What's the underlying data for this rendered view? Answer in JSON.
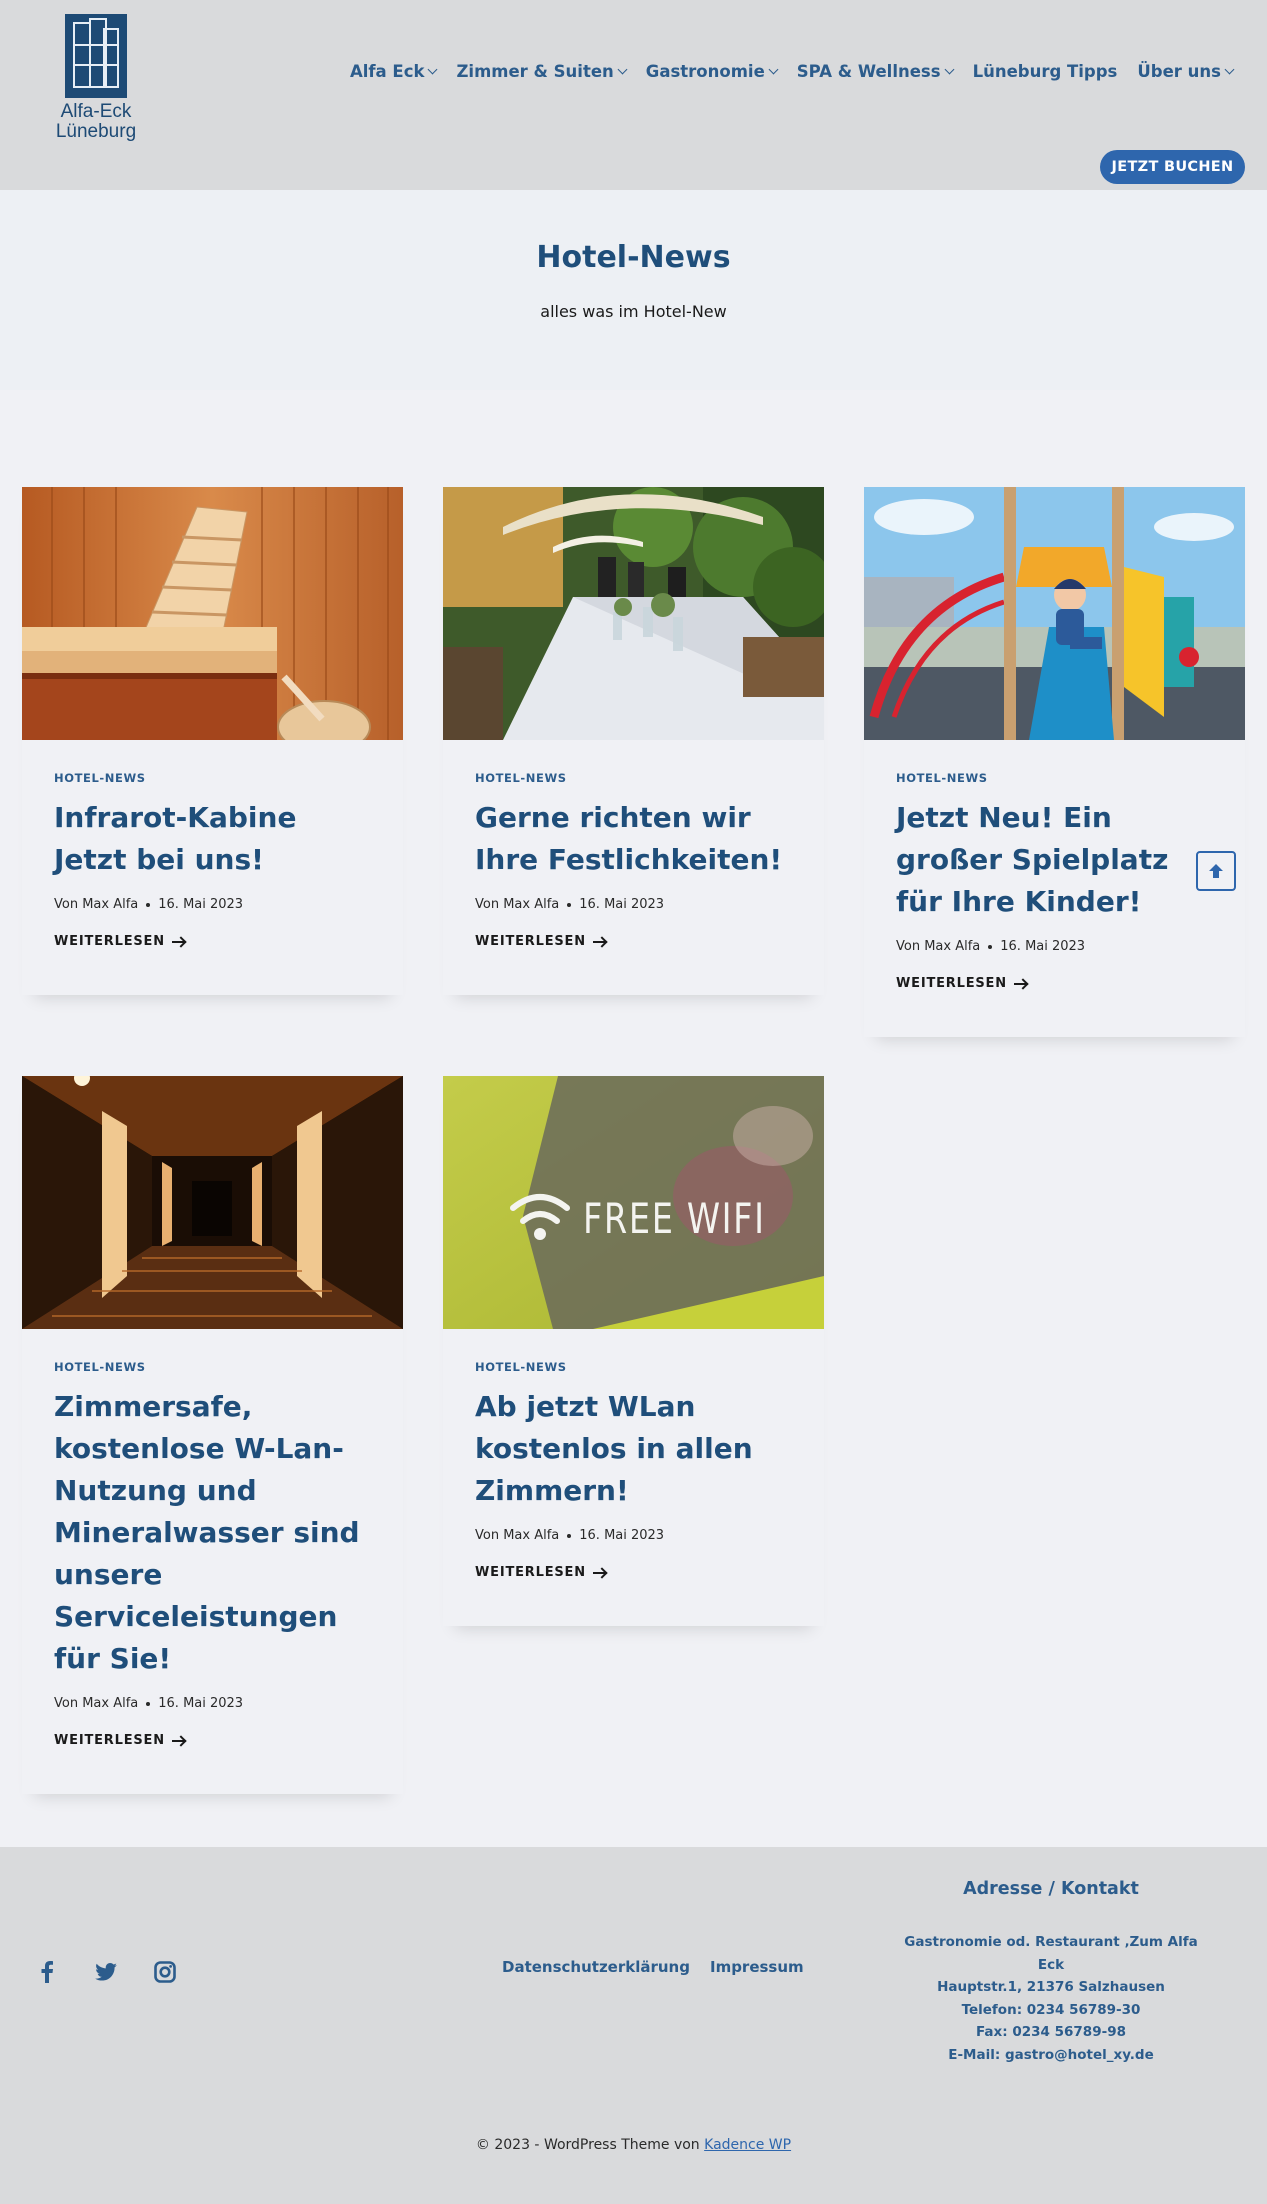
{
  "header": {
    "logo": {
      "line1": "Alfa-Eck",
      "line2": "Lüneburg"
    },
    "nav": [
      {
        "label": "Alfa Eck",
        "dropdown": true
      },
      {
        "label": "Zimmer & Suiten",
        "dropdown": true
      },
      {
        "label": "Gastronomie",
        "dropdown": true
      },
      {
        "label": "SPA & Wellness",
        "dropdown": true
      },
      {
        "label": "Lüneburg Tipps",
        "dropdown": false
      },
      {
        "label": "Über uns",
        "dropdown": true
      }
    ],
    "book_label": "JETZT BUCHEN"
  },
  "hero": {
    "title": "Hotel-News",
    "subtitle": "alles was im Hotel-New"
  },
  "posts": [
    {
      "category": "HOTEL-NEWS",
      "title": "Infrarot-Kabine Jetzt bei uns!",
      "author": "Von Max Alfa",
      "date": "16. Mai 2023",
      "more": "WEITERLESEN",
      "image": "sauna-photo"
    },
    {
      "category": "HOTEL-NEWS",
      "title": "Gerne richten wir Ihre Festlichkeiten!",
      "author": "Von Max Alfa",
      "date": "16. Mai 2023",
      "more": "WEITERLESEN",
      "image": "garden-table-photo"
    },
    {
      "category": "HOTEL-NEWS",
      "title": "Jetzt Neu! Ein großer Spielplatz für Ihre Kinder!",
      "author": "Von Max Alfa",
      "date": "16. Mai 2023",
      "more": "WEITERLESEN",
      "image": "playground-photo"
    },
    {
      "category": "HOTEL-NEWS",
      "title": "Zimmersafe, kostenlose W-Lan-Nutzung und Mineralwasser sind unsere Serviceleistungen für Sie!",
      "author": "Von Max Alfa",
      "date": "16. Mai 2023",
      "more": "WEITERLESEN",
      "image": "hallway-photo"
    },
    {
      "category": "HOTEL-NEWS",
      "title": "Ab jetzt WLan kostenlos in allen Zimmern!",
      "author": "Von Max Alfa",
      "date": "16. Mai 2023",
      "more": "WEITERLESEN",
      "image": "free-wifi-photo",
      "image_text": "FREE WIFI"
    }
  ],
  "footer": {
    "social": [
      "facebook-icon",
      "twitter-icon",
      "instagram-icon"
    ],
    "links": [
      "Datenschutzerklärung",
      "Impressum"
    ],
    "contact_title": "Adresse / Kontakt",
    "contact_lines": [
      "Gastronomie od. Restaurant ‚Zum Alfa Eck",
      "Hauptstr.1, 21376 Salzhausen",
      "Telefon: 0234 56789-30",
      "Fax: 0234 56789-98",
      "E-Mail: gastro@hotel_xy.de"
    ],
    "copyright_prefix": "© 2023 - WordPress Theme von",
    "copyright_link": "Kadence WP"
  },
  "colors": {
    "primary": "#2c5c8c",
    "heading": "#1f4e7a",
    "button": "#2e66ad",
    "header_bg": "#d9dadc"
  }
}
